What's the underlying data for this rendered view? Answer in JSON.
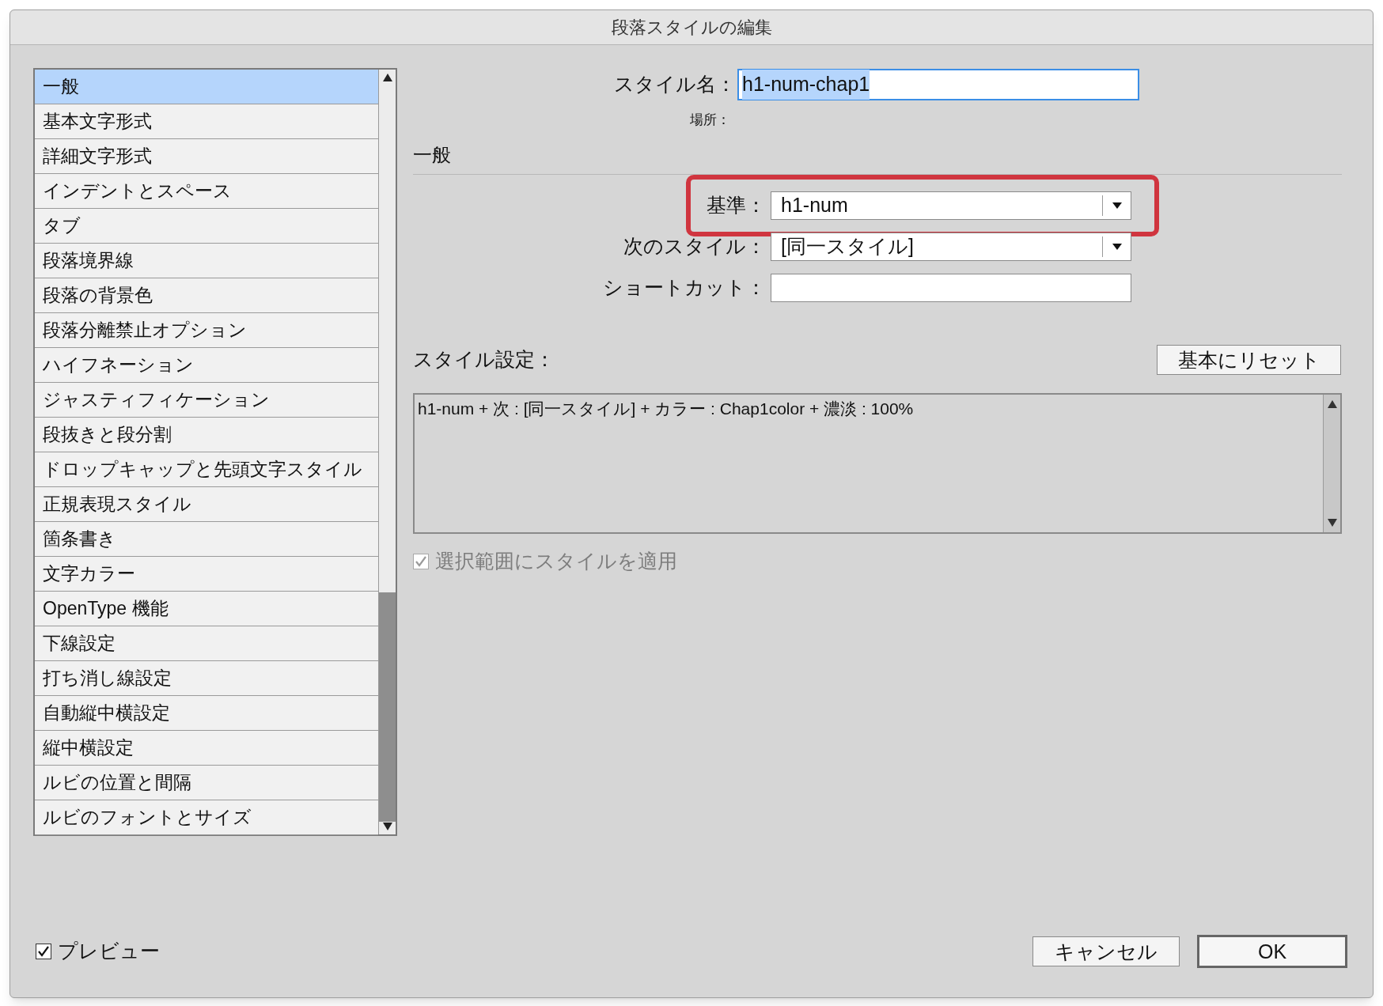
{
  "window": {
    "title": "段落スタイルの編集"
  },
  "sidebar": {
    "items": [
      {
        "label": "一般",
        "selected": true
      },
      {
        "label": "基本文字形式",
        "selected": false
      },
      {
        "label": "詳細文字形式",
        "selected": false
      },
      {
        "label": "インデントとスペース",
        "selected": false
      },
      {
        "label": "タブ",
        "selected": false
      },
      {
        "label": "段落境界線",
        "selected": false
      },
      {
        "label": "段落の背景色",
        "selected": false
      },
      {
        "label": "段落分離禁止オプション",
        "selected": false
      },
      {
        "label": "ハイフネーション",
        "selected": false
      },
      {
        "label": "ジャスティフィケーション",
        "selected": false
      },
      {
        "label": "段抜きと段分割",
        "selected": false
      },
      {
        "label": "ドロップキャップと先頭文字スタイル",
        "selected": false
      },
      {
        "label": "正規表現スタイル",
        "selected": false
      },
      {
        "label": "箇条書き",
        "selected": false
      },
      {
        "label": "文字カラー",
        "selected": false
      },
      {
        "label": "OpenType 機能",
        "selected": false
      },
      {
        "label": "下線設定",
        "selected": false
      },
      {
        "label": "打ち消し線設定",
        "selected": false
      },
      {
        "label": "自動縦中横設定",
        "selected": false
      },
      {
        "label": "縦中横設定",
        "selected": false
      },
      {
        "label": "ルビの位置と間隔",
        "selected": false
      },
      {
        "label": "ルビのフォントとサイズ",
        "selected": false
      }
    ]
  },
  "style_name": {
    "label": "スタイル名：",
    "value": "h1-num-chap1",
    "text_selected": true
  },
  "location": {
    "label": "場所："
  },
  "section_title": "一般",
  "fields": [
    {
      "kind": "dropdown",
      "label": "基準：",
      "value": "h1-num",
      "highlighted": true
    },
    {
      "kind": "dropdown",
      "label": "次のスタイル：",
      "value": "[同一スタイル]",
      "highlighted": false
    },
    {
      "kind": "text",
      "label": "ショートカット：",
      "highlighted": false
    }
  ],
  "style_settings": {
    "label": "スタイル設定：",
    "reset_button": "基本にリセット",
    "summary": "h1-num + 次 : [同一スタイル] + カラー : Chap1color + 濃淡 : 100%"
  },
  "apply_to_selection": {
    "label": "選択範囲にスタイルを適用",
    "checked": true,
    "disabled": true
  },
  "preview": {
    "label": "プレビュー",
    "checked": true
  },
  "buttons": [
    {
      "label": "キャンセル",
      "default": false
    },
    {
      "label": "OK",
      "default": true
    }
  ]
}
